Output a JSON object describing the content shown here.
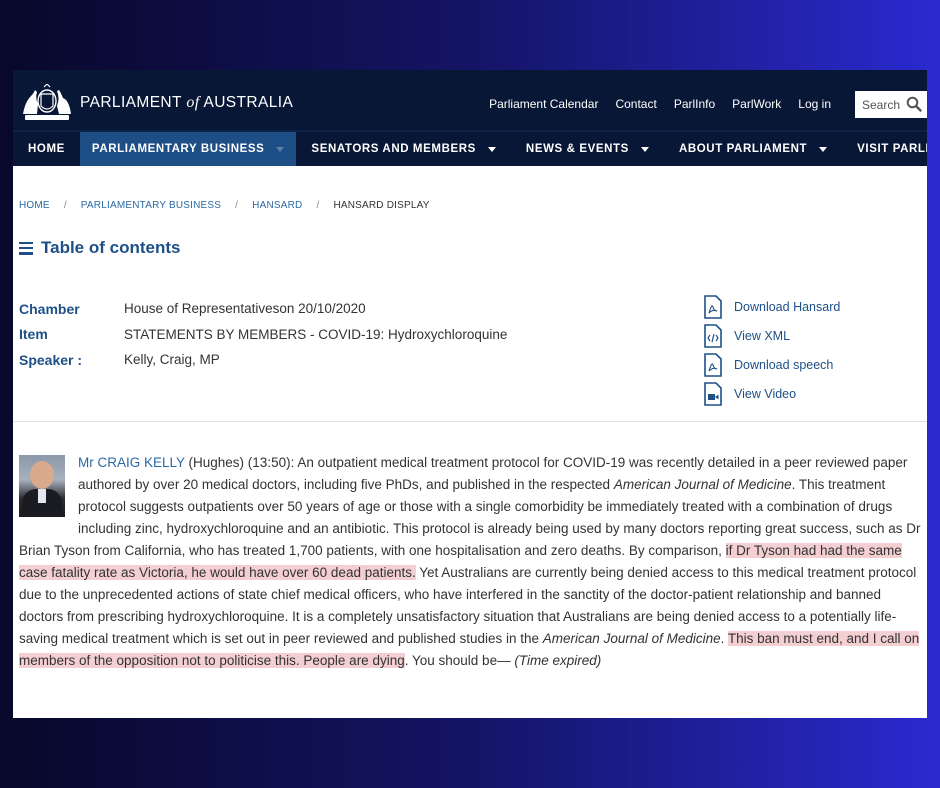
{
  "header": {
    "site_name_pre": "PARLIAMENT",
    "site_name_of": "of",
    "site_name_post": "AUSTRALIA",
    "utility_links": [
      "Parliament Calendar",
      "Contact",
      "ParlInfo",
      "ParlWork",
      "Log in"
    ],
    "search_placeholder": "Search"
  },
  "nav": {
    "items": [
      {
        "label": "HOME",
        "dropdown": false
      },
      {
        "label": "PARLIAMENTARY BUSINESS",
        "dropdown": true,
        "active": true
      },
      {
        "label": "SENATORS AND MEMBERS",
        "dropdown": true
      },
      {
        "label": "NEWS & EVENTS",
        "dropdown": true
      },
      {
        "label": "ABOUT PARLIAMENT",
        "dropdown": true
      },
      {
        "label": "VISIT PARLIAMENT",
        "dropdown": true
      }
    ]
  },
  "breadcrumb": {
    "items": [
      "HOME",
      "PARLIAMENTARY BUSINESS",
      "HANSARD"
    ],
    "current": "HANSARD DISPLAY",
    "separator": "/"
  },
  "toc_title": "Table of contents",
  "meta": {
    "chamber_label": "Chamber",
    "chamber_value": "House of Representativeson 20/10/2020",
    "item_label": "Item",
    "item_value": "STATEMENTS BY MEMBERS - COVID-19: Hydroxychloroquine",
    "speaker_label": "Speaker :",
    "speaker_value": "Kelly, Craig, MP"
  },
  "downloads": {
    "hansard": "Download Hansard",
    "xml": "View XML",
    "speech": "Download speech",
    "video": "View Video"
  },
  "speech": {
    "speaker_link": "Mr CRAIG KELLY",
    "t1": " (Hughes) (13:50): An outpatient medical treatment protocol for COVID-19 was recently detailed in a peer reviewed paper authored by over 20 medical doctors, including five PhDs, and published in the respected ",
    "journal": "American Journal of Medicine",
    "t2": ". This treatment protocol suggests outpatients over 50 years of age or those with a single comorbidity be immediately treated with a combination of drugs including zinc, hydroxychloroquine and an antibiotic. This protocol is already being used by many doctors reporting great success, such as Dr Brian Tyson from California, who has treated 1,700 patients, with one hospitalisation and zero deaths. By comparison, ",
    "hl1": "if Dr Tyson had had the same case fatality rate as Victoria, he would have over 60 dead patients.",
    "t3": " Yet Australians are currently being denied access to this medical treatment protocol due to the unprecedented actions of state chief medical officers, who have interfered in the sanctity of the doctor-patient relationship and banned doctors from prescribing hydroxychloroquine. It is a completely unsatisfactory situation that Australians are being denied access to a potentially life-saving medical treatment which is set out in peer reviewed and published studies in the ",
    "journal2": "American Journal of Medicine",
    "t4": ". ",
    "hl2": "This ban must end, and I call on members of the opposition not to politicise this. People are dying",
    "t5": ". You should be— ",
    "expired": "(Time expired)"
  },
  "colors": {
    "header_bg": "#091736",
    "nav_active": "#1e4e86",
    "link_blue": "#2a6aa5",
    "label_blue": "#1e5088",
    "highlight": "#f3cfd2"
  }
}
